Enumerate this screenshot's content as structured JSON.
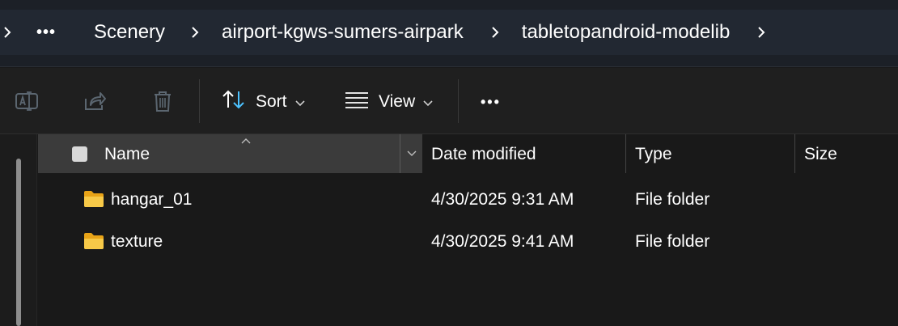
{
  "breadcrumb": {
    "more_label": "•••",
    "items": [
      {
        "label": "Scenery"
      },
      {
        "label": "airport-kgws-sumers-airpark"
      },
      {
        "label": "tabletopandroid-modelib"
      }
    ]
  },
  "command_bar": {
    "sort_label": "Sort",
    "view_label": "View",
    "more_label": "•••"
  },
  "columns": {
    "name": "Name",
    "date_modified": "Date modified",
    "type": "Type",
    "size": "Size"
  },
  "rows": [
    {
      "name": "hangar_01",
      "date": "4/30/2025 9:31 AM",
      "type": "File folder",
      "size": ""
    },
    {
      "name": "texture",
      "date": "4/30/2025 9:41 AM",
      "type": "File folder",
      "size": ""
    }
  ],
  "colors": {
    "accent": "#4cc2ff",
    "folder": "#f7c948",
    "background": "#191919",
    "header_selected": "#3b3b3b"
  }
}
